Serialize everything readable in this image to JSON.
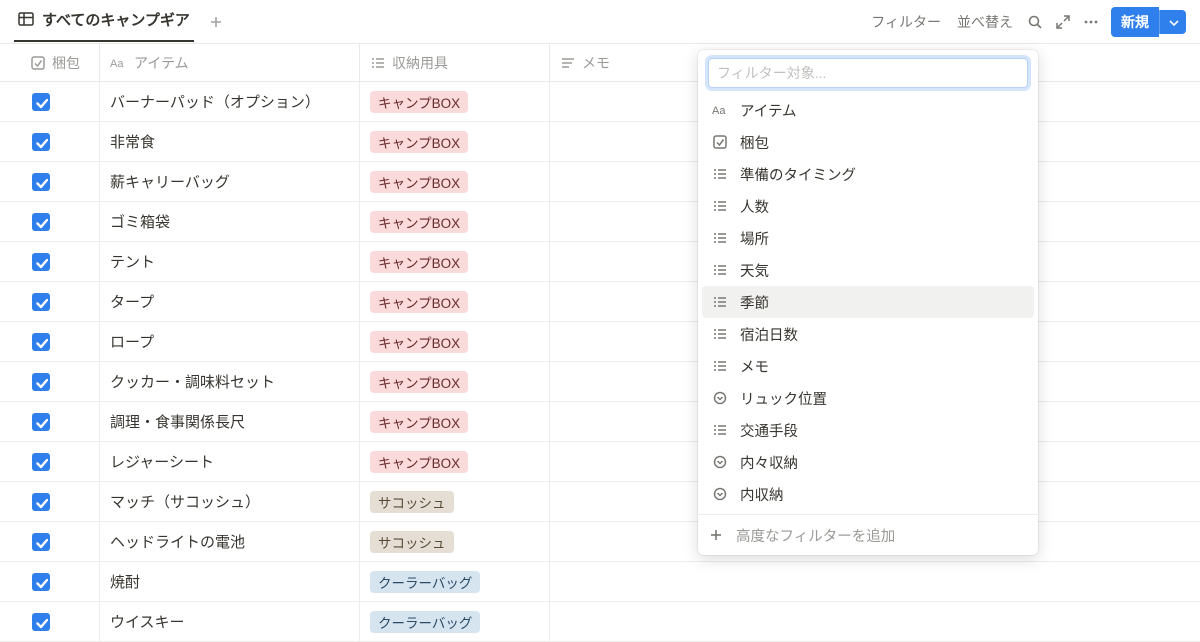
{
  "toolbar": {
    "view_tab_label": "すべてのキャンプギア",
    "filter_label": "フィルター",
    "sort_label": "並べ替え",
    "new_button_label": "新規"
  },
  "columns": {
    "checkbox": "梱包",
    "item": "アイテム",
    "storage": "収納用具",
    "memo": "メモ"
  },
  "rows": [
    {
      "checked": true,
      "item": "バーナーパッド（オプション）",
      "storage": "キャンプBOX",
      "tag": "red"
    },
    {
      "checked": true,
      "item": "非常食",
      "storage": "キャンプBOX",
      "tag": "red"
    },
    {
      "checked": true,
      "item": "薪キャリーバッグ",
      "storage": "キャンプBOX",
      "tag": "red"
    },
    {
      "checked": true,
      "item": "ゴミ箱袋",
      "storage": "キャンプBOX",
      "tag": "red"
    },
    {
      "checked": true,
      "item": "テント",
      "storage": "キャンプBOX",
      "tag": "red"
    },
    {
      "checked": true,
      "item": "タープ",
      "storage": "キャンプBOX",
      "tag": "red"
    },
    {
      "checked": true,
      "item": "ロープ",
      "storage": "キャンプBOX",
      "tag": "red"
    },
    {
      "checked": true,
      "item": "クッカー・調味料セット",
      "storage": "キャンプBOX",
      "tag": "red"
    },
    {
      "checked": true,
      "item": "調理・食事関係長尺",
      "storage": "キャンプBOX",
      "tag": "red"
    },
    {
      "checked": true,
      "item": "レジャーシート",
      "storage": "キャンプBOX",
      "tag": "red"
    },
    {
      "checked": true,
      "item": "マッチ（サコッシュ）",
      "storage": "サコッシュ",
      "tag": "brown"
    },
    {
      "checked": true,
      "item": "ヘッドライトの電池",
      "storage": "サコッシュ",
      "tag": "brown"
    },
    {
      "checked": true,
      "item": "焼酎",
      "storage": "クーラーバッグ",
      "tag": "blue"
    },
    {
      "checked": true,
      "item": "ウイスキー",
      "storage": "クーラーバッグ",
      "tag": "blue"
    }
  ],
  "filter_popover": {
    "placeholder": "フィルター対象...",
    "options": [
      {
        "icon": "text",
        "label": "アイテム"
      },
      {
        "icon": "checkbox",
        "label": "梱包"
      },
      {
        "icon": "list",
        "label": "準備のタイミング"
      },
      {
        "icon": "list",
        "label": "人数"
      },
      {
        "icon": "list",
        "label": "場所"
      },
      {
        "icon": "list",
        "label": "天気"
      },
      {
        "icon": "list",
        "label": "季節",
        "hover": true
      },
      {
        "icon": "list",
        "label": "宿泊日数"
      },
      {
        "icon": "list",
        "label": "メモ"
      },
      {
        "icon": "select",
        "label": "リュック位置"
      },
      {
        "icon": "list",
        "label": "交通手段"
      },
      {
        "icon": "select",
        "label": "内々収納"
      },
      {
        "icon": "select",
        "label": "内収納"
      }
    ],
    "advanced_label": "高度なフィルターを追加"
  }
}
